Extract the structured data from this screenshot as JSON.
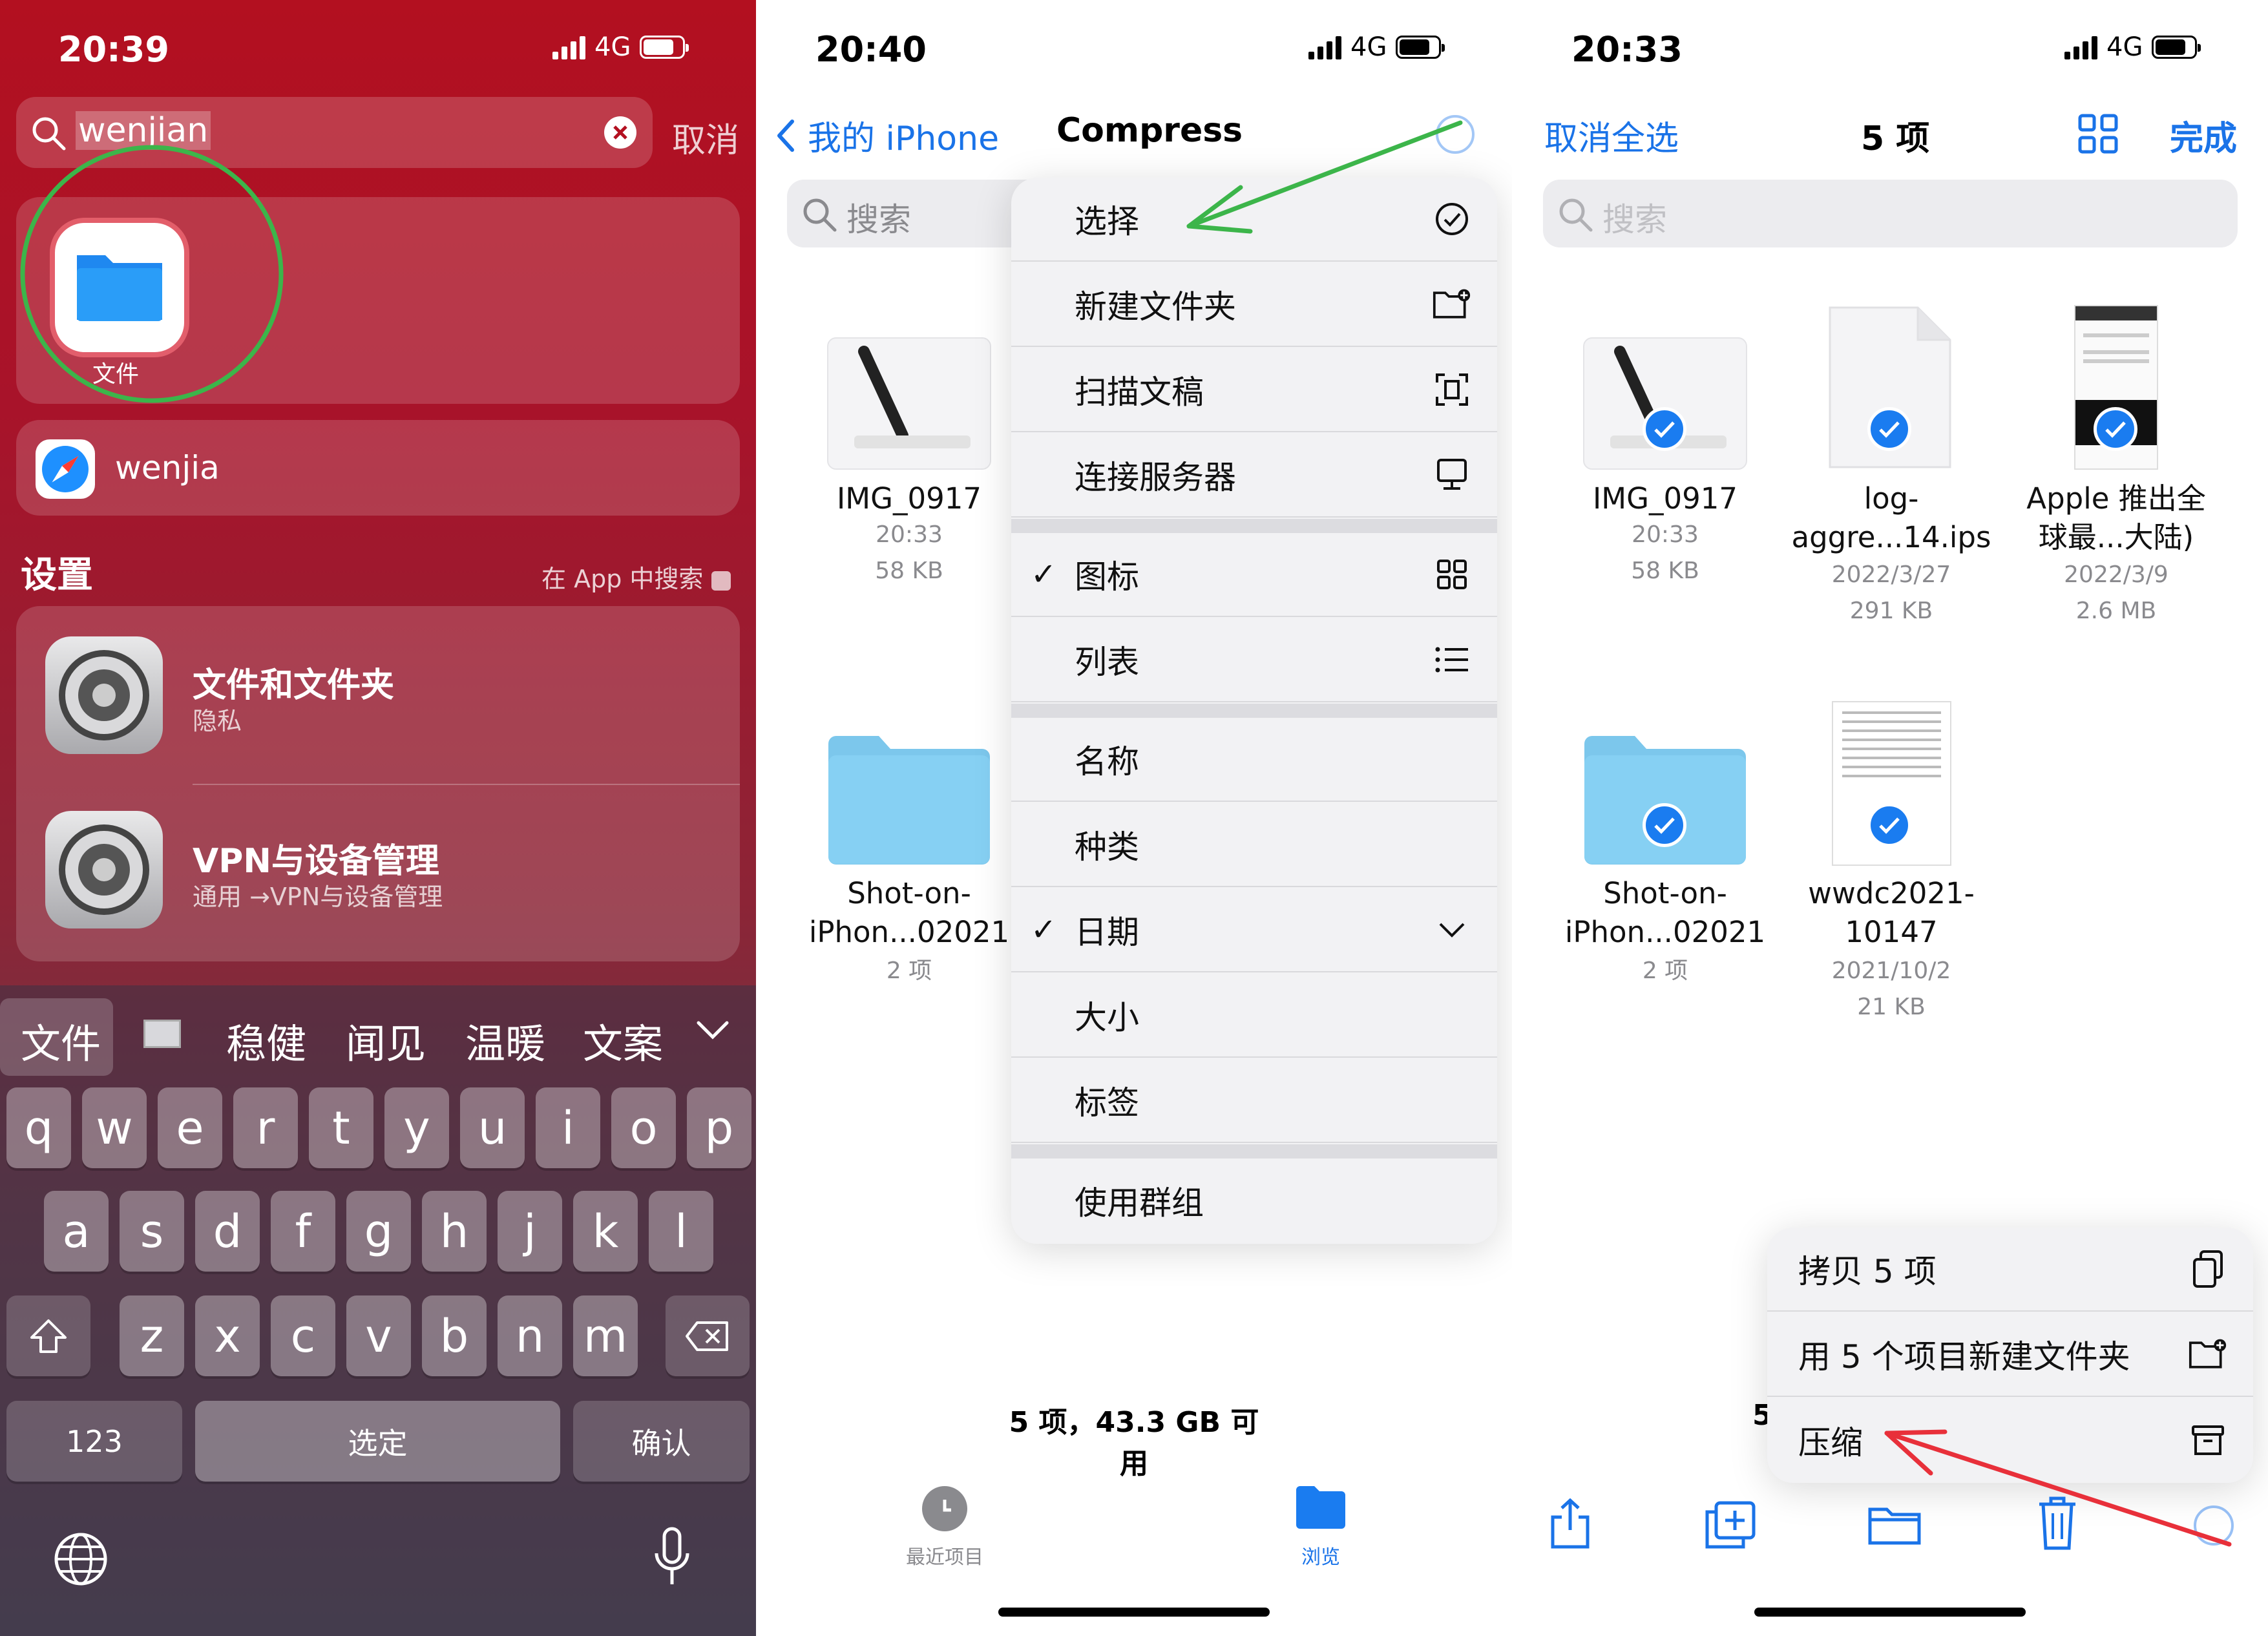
{
  "panel1": {
    "status": {
      "time": "20:39",
      "network": "4G"
    },
    "search": {
      "value": "wenjian",
      "cancel": "取消"
    },
    "app_result": {
      "label": "文件"
    },
    "web_result": {
      "label": "wenjia"
    },
    "section": {
      "title": "设置",
      "action": "在 App 中搜索"
    },
    "settings_results": [
      {
        "title": "文件和文件夹",
        "subtitle": "隐私"
      },
      {
        "title": "VPN与设备管理",
        "subtitle": "通用 →VPN与设备管理"
      }
    ],
    "candidates": [
      "文件",
      "稳健",
      "闻见",
      "温暖",
      "文案"
    ],
    "keyboard": {
      "row1": [
        "q",
        "w",
        "e",
        "r",
        "t",
        "y",
        "u",
        "i",
        "o",
        "p"
      ],
      "row2": [
        "a",
        "s",
        "d",
        "f",
        "g",
        "h",
        "j",
        "k",
        "l"
      ],
      "row3": [
        "z",
        "x",
        "c",
        "v",
        "b",
        "n",
        "m"
      ],
      "numbers": "123",
      "space": "选定",
      "confirm": "确认"
    }
  },
  "panel2": {
    "status": {
      "time": "20:40",
      "network": "4G"
    },
    "nav": {
      "back": "我的 iPhone",
      "title": "Compress"
    },
    "search_placeholder": "搜索",
    "files": [
      {
        "name": "IMG_0917",
        "meta1": "20:33",
        "meta2": "58 KB"
      },
      {
        "name": "Shot-on-iPhon...02021",
        "meta1": "2 项"
      }
    ],
    "menu": {
      "select": "选择",
      "new_folder": "新建文件夹",
      "scan": "扫描文稿",
      "connect": "连接服务器",
      "icons": "图标",
      "list": "列表",
      "name": "名称",
      "kind": "种类",
      "date": "日期",
      "size": "大小",
      "tags": "标签",
      "groups": "使用群组"
    },
    "footer": "5 项，43.3 GB 可用",
    "tabs": {
      "recent": "最近项目",
      "browse": "浏览"
    }
  },
  "panel3": {
    "status": {
      "time": "20:33",
      "network": "4G"
    },
    "nav": {
      "deselect": "取消全选",
      "count": "5 项",
      "done": "完成"
    },
    "search_placeholder": "搜索",
    "files": [
      {
        "name": "IMG_0917",
        "meta1": "20:33",
        "meta2": "58 KB"
      },
      {
        "name": "log-aggre...14.ips",
        "meta1": "2022/3/27",
        "meta2": "291 KB"
      },
      {
        "name": "Apple 推出全球最...大陆)",
        "meta1": "2022/3/9",
        "meta2": "2.6 MB"
      },
      {
        "name": "Shot-on-iPhon...02021",
        "meta1": "2 项"
      },
      {
        "name": "wwdc2021-10147",
        "meta1": "2021/10/2",
        "meta2": "21 KB"
      }
    ],
    "menu": {
      "copy": "拷贝 5 项",
      "new_folder": "用 5 个项目新建文件夹",
      "compress": "压缩"
    },
    "footer_partial": "5"
  },
  "colors": {
    "accent": "#1a73e8",
    "annotation_green": "#3cb54a",
    "annotation_red": "#e8303a",
    "search_red": "#b31020"
  }
}
